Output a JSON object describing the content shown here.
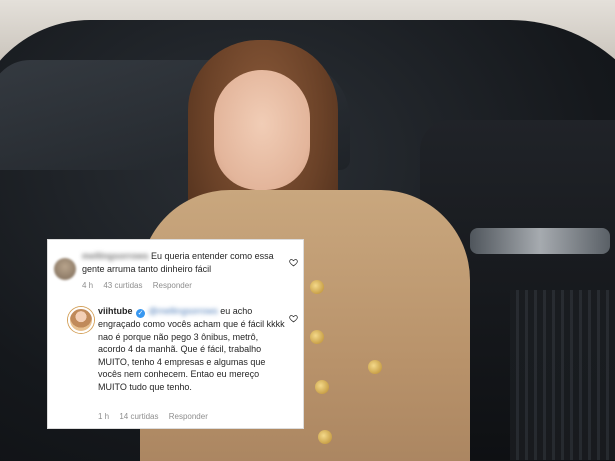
{
  "comments": [
    {
      "username": "mellingsorrows",
      "text": "Eu queria entender como essa gente arruma tanto dinheiro fácil",
      "age": "4 h",
      "likes": "43 curtidas",
      "reply_label": "Responder"
    },
    {
      "username": "viihtube",
      "mention": "@mellingsorrows",
      "text": "eu acho engraçado como vocês acham que é fácil kkkk nao é porque não pego 3 ônibus, metrô, acordo 4 da manhã. Que é fácil, trabalho MUITO, tenho 4 empresas e algumas que vocês nem conhecem. Entao eu mereço MUITO tudo que tenho.",
      "age": "1 h",
      "likes": "14 curtidas",
      "reply_label": "Responder"
    }
  ],
  "icons": {
    "heart": "heart-outline-icon",
    "verified": "verified-badge-icon"
  },
  "colors": {
    "verified_blue": "#3897f0",
    "meta_gray": "#8e8e8e",
    "text": "#262626"
  }
}
